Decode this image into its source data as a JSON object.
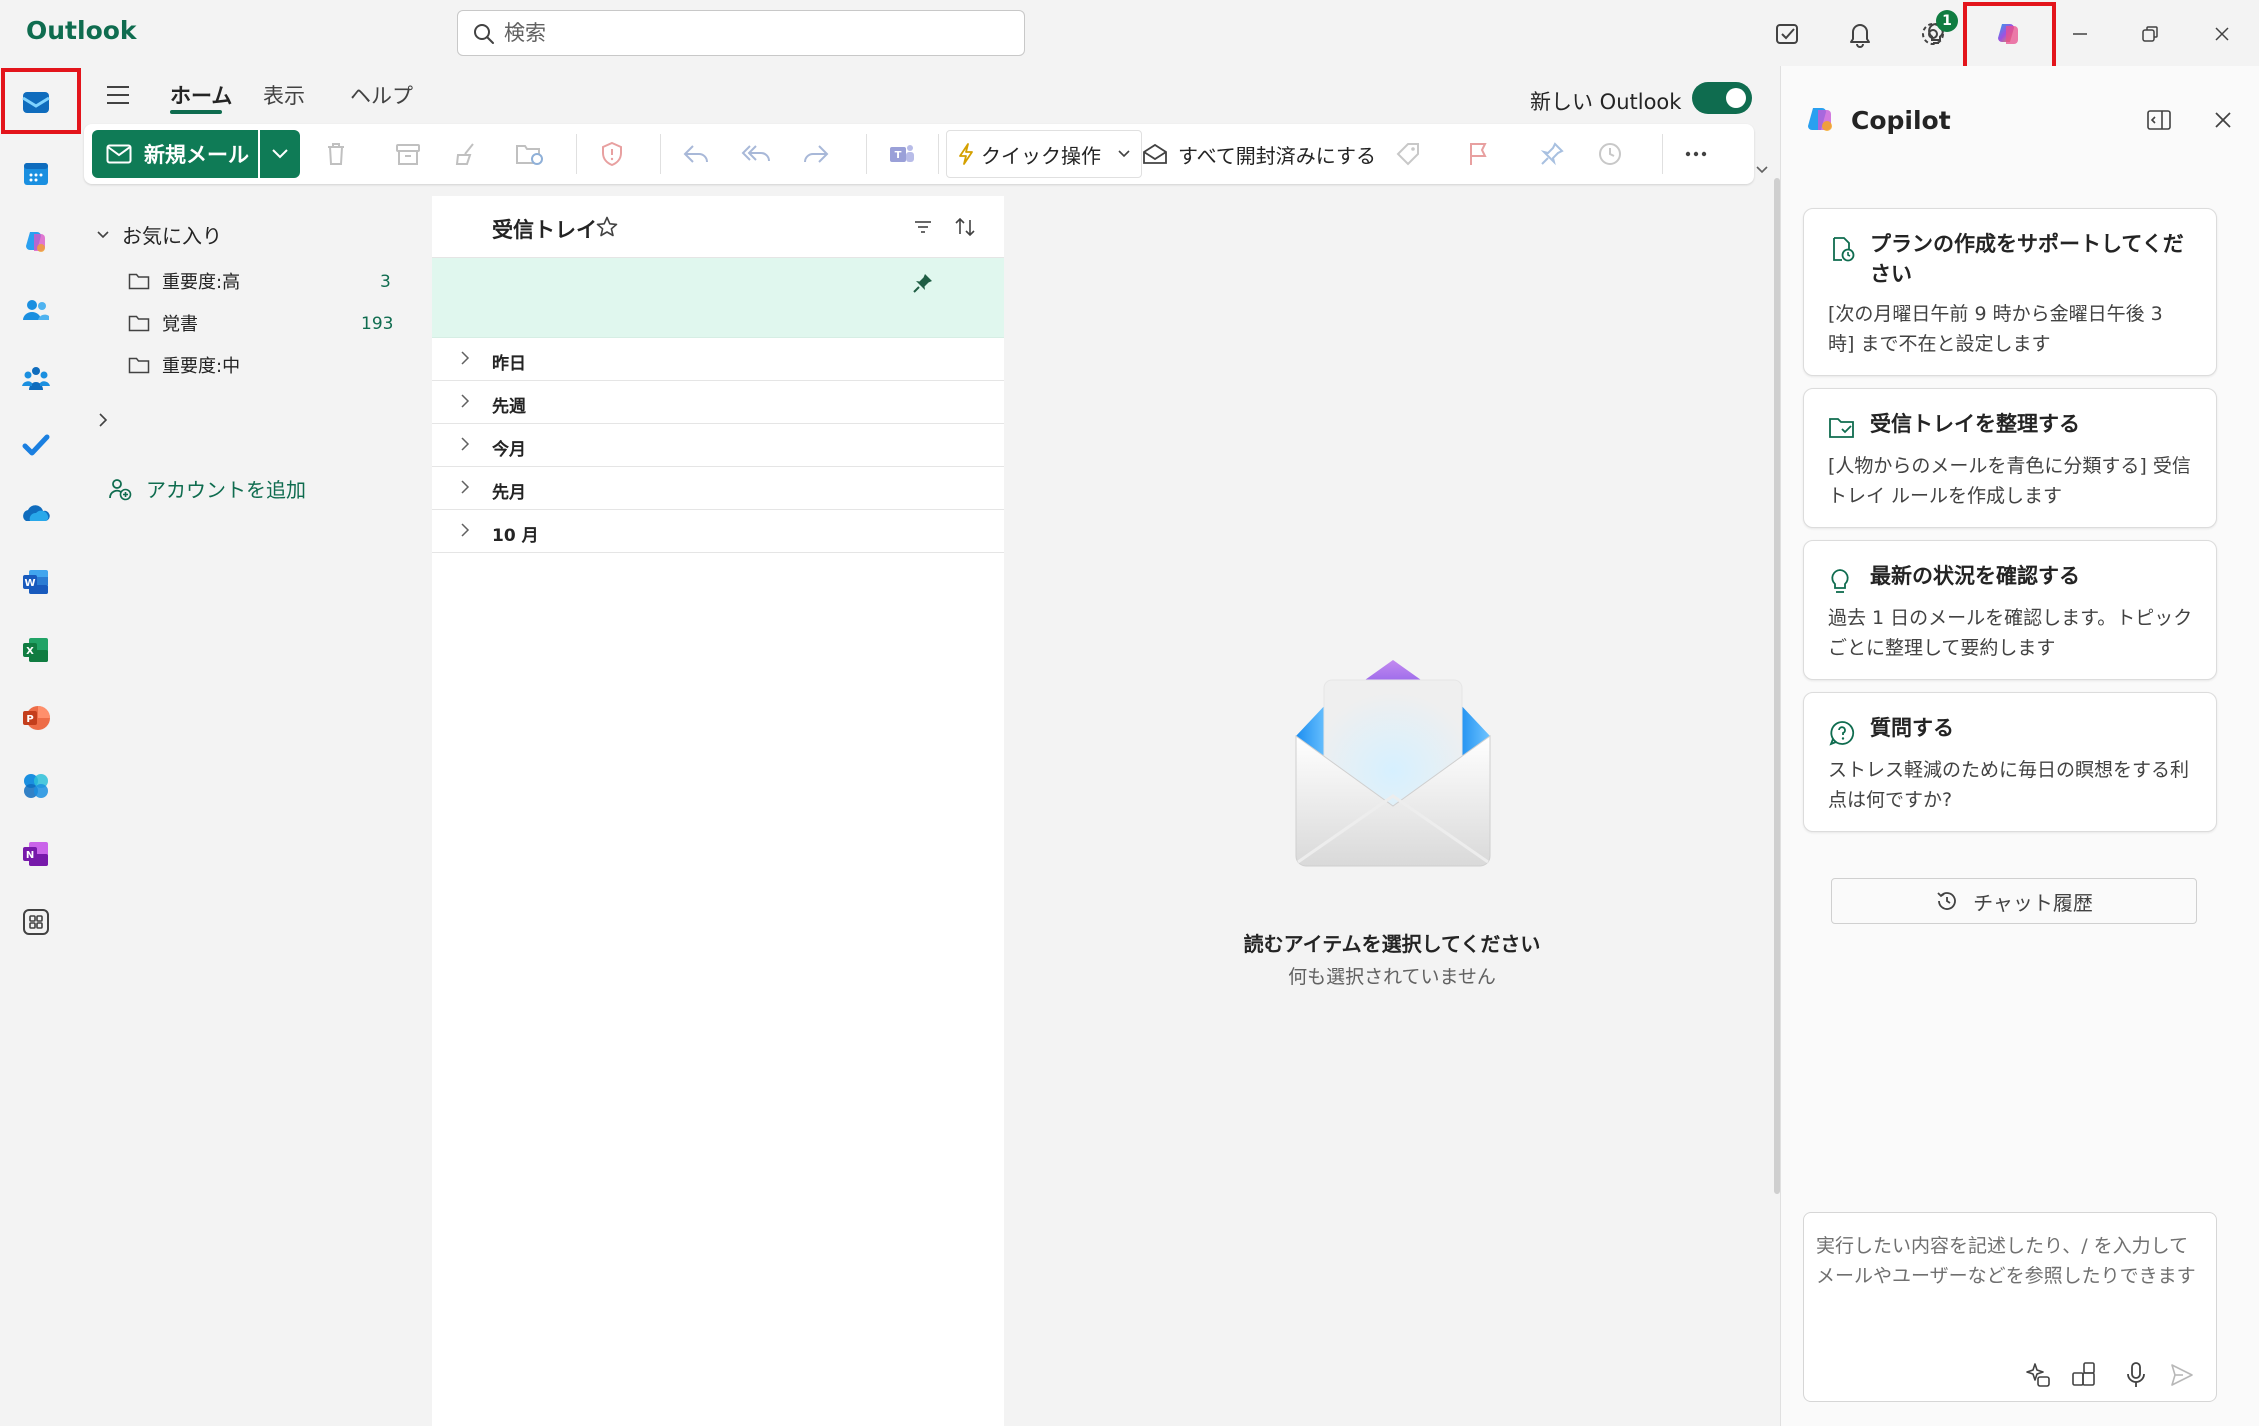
{
  "app": {
    "title": "Outlook"
  },
  "search": {
    "placeholder": "検索",
    "value": ""
  },
  "titlebar": {
    "notification_badge": "1"
  },
  "ribbon": {
    "tabs": [
      {
        "label": "ホーム",
        "active": true
      },
      {
        "label": "表示",
        "active": false
      },
      {
        "label": "ヘルプ",
        "active": false
      }
    ],
    "new_mail_label": "新規メール",
    "quick_steps_label": "クイック操作",
    "mark_all_read_label": "すべて開封済みにする",
    "new_outlook_label": "新しい Outlook",
    "new_outlook_enabled": true
  },
  "folders": {
    "favorites_label": "お気に入り",
    "items": [
      {
        "label": "重要度:高",
        "count": "3"
      },
      {
        "label": "覚書",
        "count": "193"
      },
      {
        "label": "重要度:中",
        "count": ""
      }
    ],
    "add_account_label": "アカウントを追加"
  },
  "message_list": {
    "title": "受信トレイ",
    "groups": [
      "昨日",
      "先週",
      "今月",
      "先月",
      "10 月"
    ]
  },
  "reading_pane": {
    "empty_title": "読むアイテムを選択してください",
    "empty_subtitle": "何も選択されていません"
  },
  "copilot": {
    "title": "Copilot",
    "cards": [
      {
        "icon": "plan-icon",
        "title": "プランの作成をサポートしてください",
        "desc": "[次の月曜日午前 9 時から金曜日午後 3 時] まで不在と設定します"
      },
      {
        "icon": "folder-organize-icon",
        "title": "受信トレイを整理する",
        "desc": "[人物からのメールを青色に分類する] 受信トレイ ルールを作成します"
      },
      {
        "icon": "lightbulb-icon",
        "title": "最新の状況を確認する",
        "desc": "過去 1 日のメールを確認します。トピックごとに整理して要約します"
      },
      {
        "icon": "question-chat-icon",
        "title": "質問する",
        "desc": "ストレス軽減のために毎日の瞑想をする利点は何ですか?"
      }
    ],
    "chat_history_label": "チャット履歴",
    "compose_placeholder": "実行したい内容を記述したり、/ を入力してメールやユーザーなどを参照したりできます"
  },
  "colors": {
    "brand": "#0f6c4f",
    "new_mail_button": "#0f7b56",
    "pinned_row": "#e0f7ee",
    "highlight_box": "#e3141b"
  }
}
